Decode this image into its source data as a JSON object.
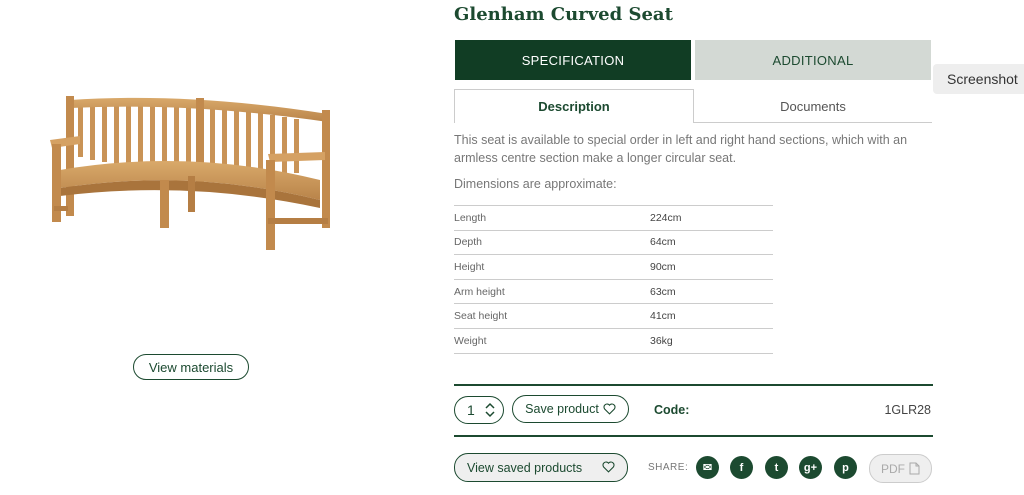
{
  "product": {
    "title": "Glenham Curved Seat",
    "image_alt": "curved teak bench"
  },
  "tabs": {
    "main": [
      {
        "label": "SPECIFICATION",
        "active": true
      },
      {
        "label": "ADDITIONAL",
        "active": false
      }
    ],
    "sub": [
      {
        "label": "Description",
        "active": true
      },
      {
        "label": "Documents",
        "active": false
      }
    ]
  },
  "tooltip": {
    "label": "Screenshot"
  },
  "description": {
    "text": "This seat is available to special order in left and right hand sections, which with an armless centre section make a longer circular seat.",
    "dims_note": "Dimensions are approximate:"
  },
  "dimensions": [
    {
      "label": "Length",
      "value": "224cm"
    },
    {
      "label": "Depth",
      "value": "64cm"
    },
    {
      "label": "Height",
      "value": "90cm"
    },
    {
      "label": "Arm height",
      "value": "63cm"
    },
    {
      "label": "Seat height",
      "value": "41cm"
    },
    {
      "label": "Weight",
      "value": "36kg"
    }
  ],
  "buttons": {
    "view_materials": "View materials",
    "save_product": "Save product",
    "view_saved": "View saved products",
    "pdf": "PDF"
  },
  "purchase": {
    "quantity": "1",
    "code_label": "Code:",
    "code_value": "1GLR28"
  },
  "share": {
    "label": "SHARE:",
    "icons": [
      "email-icon",
      "facebook-icon",
      "twitter-icon",
      "google-plus-icon",
      "pinterest-icon"
    ],
    "glyphs": [
      "✉",
      "f",
      "t",
      "g+",
      "p"
    ]
  },
  "colors": {
    "brand_green": "#113d24",
    "muted_tab": "#d3d9d4"
  }
}
